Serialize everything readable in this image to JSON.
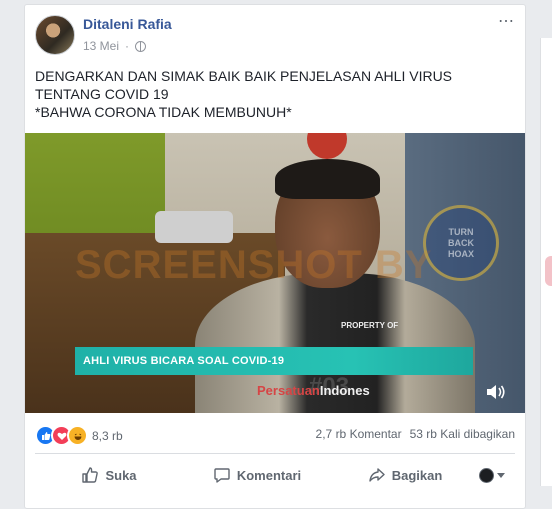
{
  "post": {
    "author": "Ditaleni Rafia",
    "date": "13 Mei",
    "more_icon": "⋯",
    "text_lines": [
      "DENGARKAN DAN SIMAK BAIK BAIK PENJELASAN AHLI VIRUS",
      "TENTANG COVID 19",
      "*BAHWA CORONA TIDAK MEMBUNUH*"
    ]
  },
  "video": {
    "watermark": "SCREENSHOT BY",
    "badge_lines": [
      "TURN",
      "BACK",
      "HOAX"
    ],
    "property_text": "PROPERTY OF",
    "lower_third": "AHLI VIRUS BICARA SOAL COVID-19",
    "shirt_number": "#03",
    "shirt_text_prefix": "Persatuan",
    "shirt_text_suffix": "Indones"
  },
  "stats": {
    "reaction_icons": [
      "like-icon",
      "love-icon",
      "haha-icon"
    ],
    "reactions_count": "8,3 rb",
    "comments": "2,7 rb Komentar",
    "shares": "53 rb Kali dibagikan"
  },
  "actions": {
    "like": "Suka",
    "comment": "Komentari",
    "share": "Bagikan"
  },
  "colors": {
    "author": "#385898",
    "lower_third": "#27c2b4",
    "like_blue": "#1877f2"
  }
}
